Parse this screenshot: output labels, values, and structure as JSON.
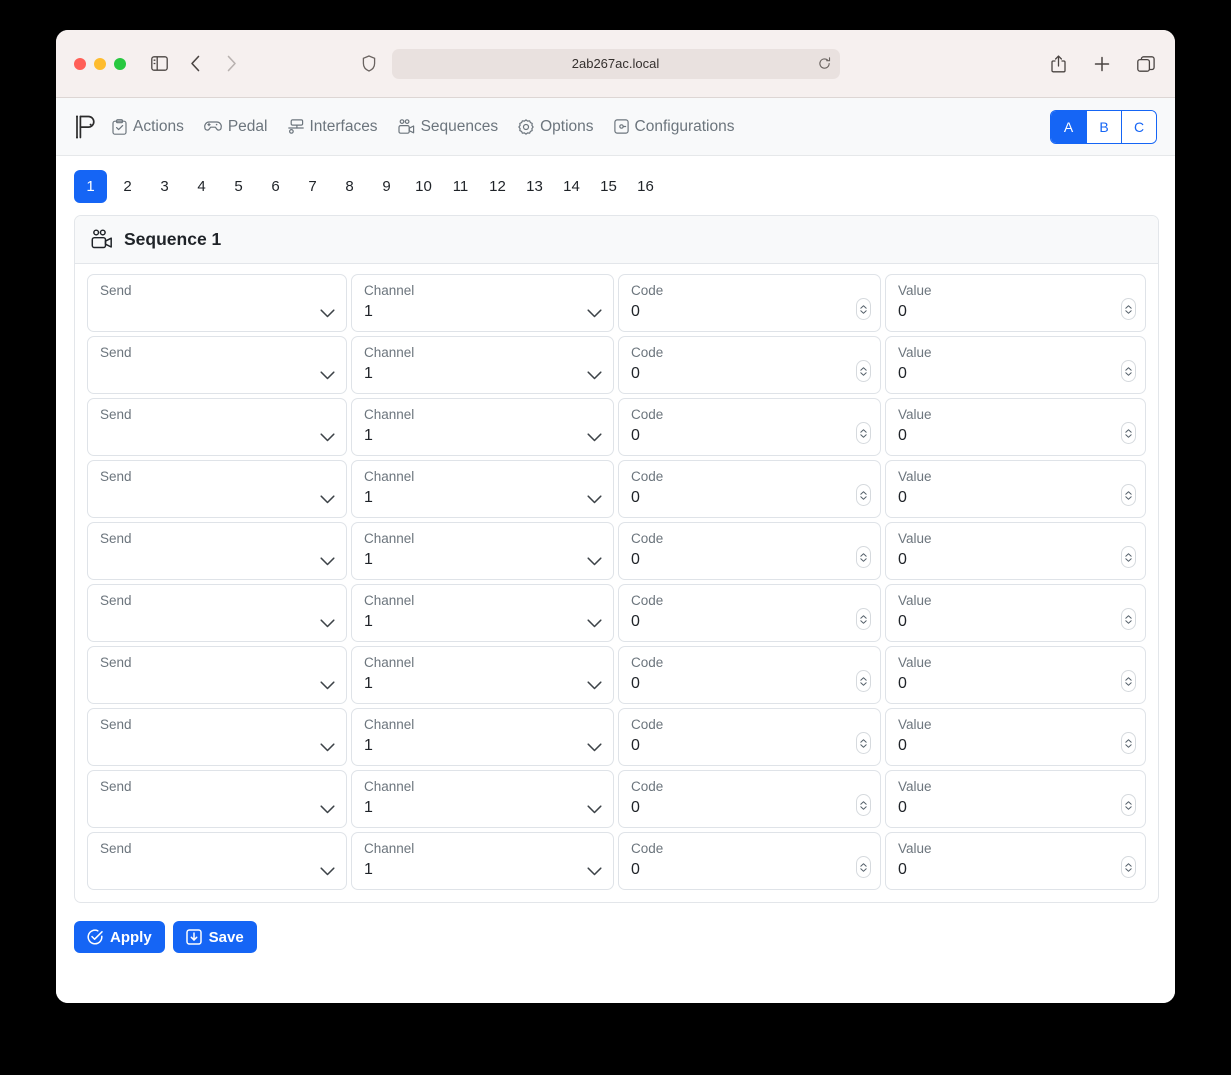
{
  "browser": {
    "url": "2ab267ac.local",
    "icons": {
      "sidebar": "sidebar-toggle-icon",
      "back": "back-arrow-icon",
      "forward": "forward-arrow-icon",
      "shield": "privacy-shield-icon",
      "reload": "reload-icon",
      "share": "share-icon",
      "new_tab": "plus-icon",
      "tab_overview": "tab-overview-icon"
    }
  },
  "navbar": {
    "logo": "pedalino-logo",
    "items": [
      {
        "label": "Actions",
        "icon": "clipboard-check-icon"
      },
      {
        "label": "Pedal",
        "icon": "gamepad-icon"
      },
      {
        "label": "Interfaces",
        "icon": "network-icon"
      },
      {
        "label": "Sequences",
        "icon": "video-camera-icon"
      },
      {
        "label": "Options",
        "icon": "gear-icon"
      },
      {
        "label": "Configurations",
        "icon": "boxed-dot-icon"
      }
    ],
    "bank_selector": {
      "options": [
        "A",
        "B",
        "C"
      ],
      "selected": "A"
    }
  },
  "pages": {
    "items": [
      "1",
      "2",
      "3",
      "4",
      "5",
      "6",
      "7",
      "8",
      "9",
      "10",
      "11",
      "12",
      "13",
      "14",
      "15",
      "16"
    ],
    "selected": "1"
  },
  "sequence_card": {
    "icon": "video-camera-icon",
    "title": "Sequence 1",
    "column_labels": {
      "send": "Send",
      "channel": "Channel",
      "code": "Code",
      "value": "Value"
    },
    "rows": [
      {
        "send": "",
        "channel": "1",
        "code": "0",
        "value": "0"
      },
      {
        "send": "",
        "channel": "1",
        "code": "0",
        "value": "0"
      },
      {
        "send": "",
        "channel": "1",
        "code": "0",
        "value": "0"
      },
      {
        "send": "",
        "channel": "1",
        "code": "0",
        "value": "0"
      },
      {
        "send": "",
        "channel": "1",
        "code": "0",
        "value": "0"
      },
      {
        "send": "",
        "channel": "1",
        "code": "0",
        "value": "0"
      },
      {
        "send": "",
        "channel": "1",
        "code": "0",
        "value": "0"
      },
      {
        "send": "",
        "channel": "1",
        "code": "0",
        "value": "0"
      },
      {
        "send": "",
        "channel": "1",
        "code": "0",
        "value": "0"
      },
      {
        "send": "",
        "channel": "1",
        "code": "0",
        "value": "0"
      }
    ]
  },
  "footer": {
    "apply_label": "Apply",
    "apply_icon": "check-circle-icon",
    "save_label": "Save",
    "save_icon": "save-box-icon"
  },
  "colors": {
    "accent": "#1565f5",
    "chrome_bg": "#f6f0ef",
    "panel_bg": "#f8f9fa",
    "border": "#e3e6ea",
    "muted_text": "#6c757d"
  }
}
